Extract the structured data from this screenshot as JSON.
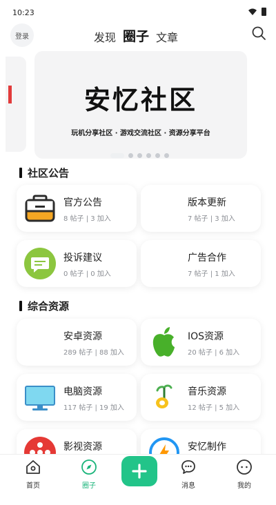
{
  "status": {
    "time": "10:23"
  },
  "header": {
    "login_label": "登录",
    "tabs": [
      {
        "label": "发现"
      },
      {
        "label": "圈子"
      },
      {
        "label": "文章"
      }
    ]
  },
  "banner": {
    "title": "安忆社区",
    "subtitle": "玩机分享社区 ·  游戏交流社区 ·  资源分享平台"
  },
  "sections": {
    "announcements": {
      "title": "社区公告",
      "cards": [
        {
          "name": "官方公告",
          "stats": "8 帖子 | 3 加入",
          "icon": "briefcase-icon"
        },
        {
          "name": "版本更新",
          "stats": "7 帖子 | 3 加入",
          "icon": ""
        },
        {
          "name": "投诉建议",
          "stats": "0 帖子 | 0 加入",
          "icon": "feedback-chat-icon"
        },
        {
          "name": "广告合作",
          "stats": "7 帖子 | 1 加入",
          "icon": ""
        }
      ]
    },
    "resources": {
      "title": "综合资源",
      "cards": [
        {
          "name": "安卓资源",
          "stats": "289 帖子 | 88 加入",
          "icon": ""
        },
        {
          "name": "IOS资源",
          "stats": "20 帖子 | 6 加入",
          "icon": "apple-icon"
        },
        {
          "name": "电脑资源",
          "stats": "117 帖子 | 19 加入",
          "icon": "monitor-icon"
        },
        {
          "name": "音乐资源",
          "stats": "12 帖子 | 5 加入",
          "icon": "music-note-icon"
        },
        {
          "name": "影视资源",
          "stats": "",
          "icon": "film-reel-icon"
        },
        {
          "name": "安忆制作",
          "stats": "",
          "icon": "lightning-icon"
        }
      ]
    }
  },
  "tabbar": {
    "items": [
      {
        "label": "首页"
      },
      {
        "label": "圈子"
      },
      {
        "label": "消息"
      },
      {
        "label": "我的"
      }
    ]
  },
  "colors": {
    "accent": "#22c489",
    "active_tab_label": "#19b47a",
    "card_bg": "#ffffff",
    "banner_bg": "#f4f4f5"
  }
}
